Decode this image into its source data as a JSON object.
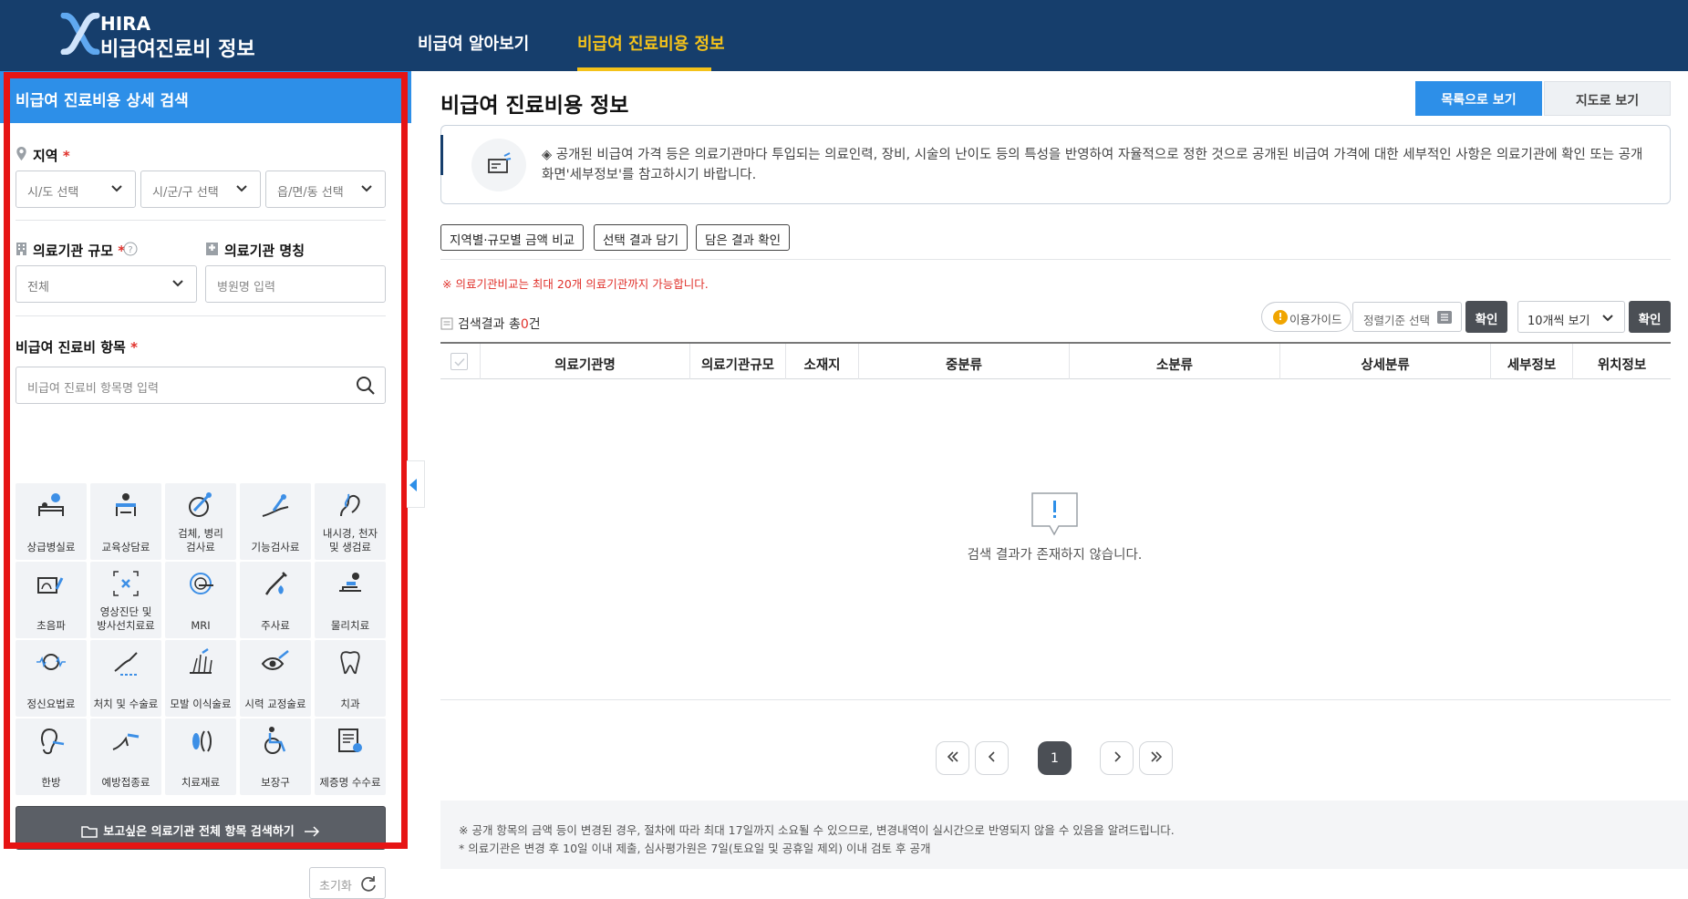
{
  "header": {
    "logo_top": "HIRA",
    "logo_bottom": "비급여진료비 정보",
    "nav": [
      {
        "label": "비급여 알아보기"
      },
      {
        "label": "비급여 진료비용 정보",
        "active": true
      }
    ],
    "colors": {
      "bar": "#163e6c",
      "active": "#f4c21a"
    }
  },
  "sidebar": {
    "title": "비급여 진료비용 상세 검색",
    "region_label": "지역",
    "required_mark": "*",
    "region_selects": [
      "시/도 선택",
      "시/군/구 선택",
      "읍/면/동 선택"
    ],
    "scale_label": "의료기관 규모",
    "scale_value": "전체",
    "name_label": "의료기관 명칭",
    "name_placeholder": "병원명 입력",
    "item_label": "비급여 진료비 항목",
    "item_placeholder": "비급여 진료비 항목명 입력",
    "categories": [
      {
        "label": "상급병실료",
        "icon": "hospital-bed-icon"
      },
      {
        "label": "교육상담료",
        "icon": "consultation-desk-icon"
      },
      {
        "label": "검체, 병리\n검사료",
        "icon": "microscope-sample-icon"
      },
      {
        "label": "기능검사료",
        "icon": "hand-sensor-icon"
      },
      {
        "label": "내시경, 천자\n및 생검료",
        "icon": "endoscope-icon"
      },
      {
        "label": "초음파",
        "icon": "ultrasound-icon"
      },
      {
        "label": "영상진단 및\n방사선치료료",
        "icon": "xray-scan-icon"
      },
      {
        "label": "MRI",
        "icon": "mri-machine-icon"
      },
      {
        "label": "주사료",
        "icon": "syringe-icon"
      },
      {
        "label": "물리치료",
        "icon": "physical-therapy-icon"
      },
      {
        "label": "정신요법료",
        "icon": "brain-wave-icon"
      },
      {
        "label": "처치 및 수술료",
        "icon": "surgery-hand-icon"
      },
      {
        "label": "모발 이식술료",
        "icon": "hair-transplant-icon"
      },
      {
        "label": "시력 교정술료",
        "icon": "eye-laser-icon"
      },
      {
        "label": "치과",
        "icon": "tooth-icon"
      },
      {
        "label": "한방",
        "icon": "ear-acupuncture-icon"
      },
      {
        "label": "예방접종료",
        "icon": "vaccination-arm-icon"
      },
      {
        "label": "치료재료",
        "icon": "treatment-material-icon"
      },
      {
        "label": "보장구",
        "icon": "wheelchair-icon"
      },
      {
        "label": "제증명 수수료",
        "icon": "certificate-fee-icon"
      }
    ],
    "all_search_button": "보고싶은 의료기관 전체 항목 검색하기",
    "reset_button": "초기화"
  },
  "main": {
    "title": "비급여 진료비용 정보",
    "view_list": "목록으로 보기",
    "view_map": "지도로 보기",
    "notice": "◈ 공개된 비급여 가격 등은 의료기관마다 투입되는 의료인력, 장비, 시술의 난이도 등의 특성을 반영하여 자율적으로 정한 것으로 공개된 비급여 가격에 대한 세부적인 사항은 의료기관에 확인 또는 공개화면'세부정보'를 참고하시기 바랍니다.",
    "action_buttons": [
      "지역별·규모별 금액 비교",
      "선택 결과 담기",
      "담은 결과 확인"
    ],
    "compare_warning": "※ 의료기관비교는 최대 20개 의료기관까지 가능합니다.",
    "result_prefix": "검색결과 총",
    "result_count": "0",
    "result_suffix": "건",
    "guide_button": "이용가이드",
    "sort_select": "정렬기준 선택",
    "confirm": "확인",
    "page_size": "10개씩 보기",
    "columns": [
      "의료기관명",
      "의료기관규모",
      "소재지",
      "중분류",
      "소분류",
      "상세분류",
      "세부정보",
      "위치정보"
    ],
    "empty_message": "검색 결과가 존재하지 않습니다.",
    "pagination": {
      "current": "1"
    },
    "footer_lines": [
      "※ 공개 항목의 금액 등이 변경된 경우, 절차에 따라 최대 17일까지 소요될 수 있으므로, 변경내역이 실시간으로 반영되지 않을 수 있음을 알려드립니다.",
      "* 의료기관은 변경 후 10일 이내 제출, 심사평가원은 7일(토요일 및 공휴일 제외) 이내 검토 후 공개"
    ],
    "colors": {
      "primary": "#2d8fe8",
      "warning": "#e0302a"
    }
  }
}
